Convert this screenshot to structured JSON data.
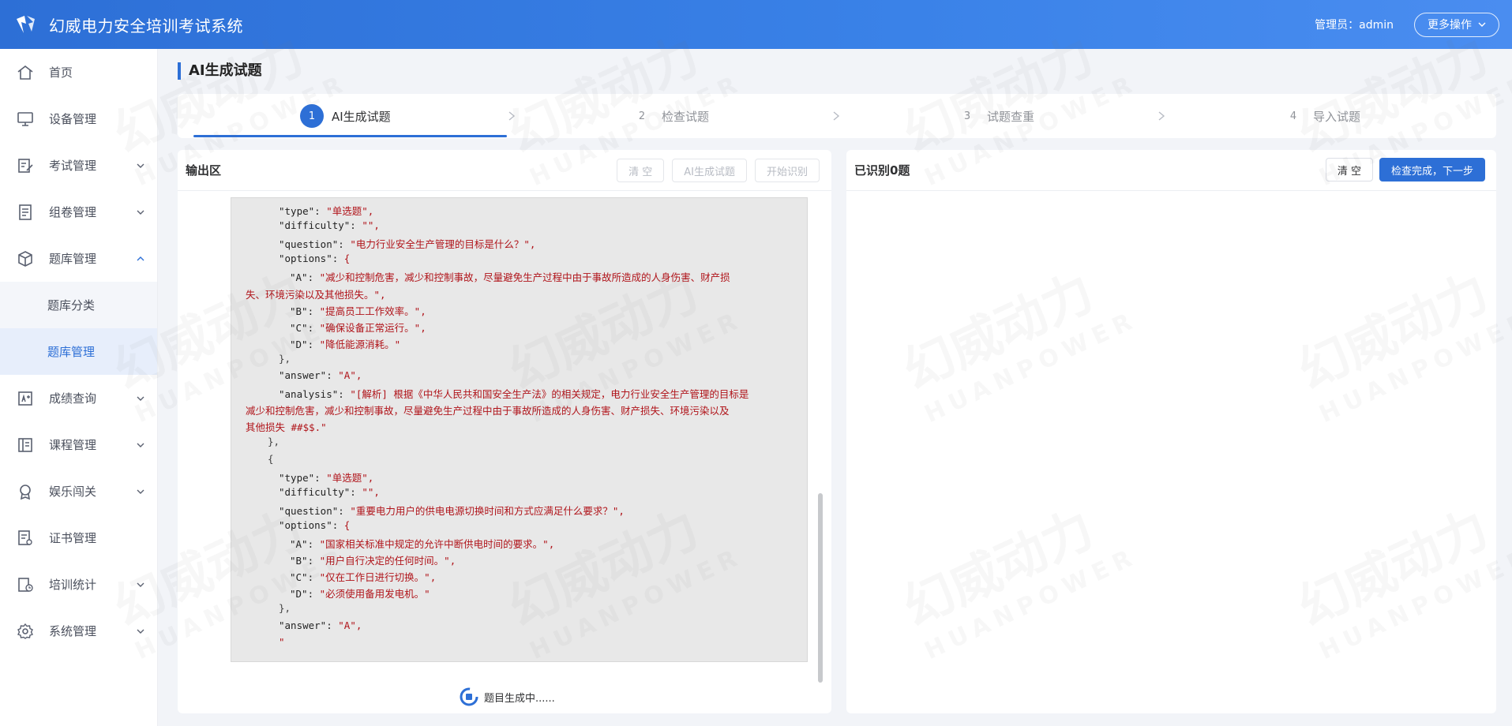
{
  "header": {
    "app_title": "幻威电力安全培训考试系统",
    "admin_label": "管理员：admin",
    "more_label": "更多操作"
  },
  "sidebar": {
    "items": [
      {
        "label": "首页",
        "icon": "home-icon"
      },
      {
        "label": "设备管理",
        "icon": "monitor-icon"
      },
      {
        "label": "考试管理",
        "icon": "edit-doc-icon"
      },
      {
        "label": "组卷管理",
        "icon": "paper-icon"
      },
      {
        "label": "题库管理",
        "icon": "box-icon"
      },
      {
        "label": "成绩查询",
        "icon": "score-icon"
      },
      {
        "label": "课程管理",
        "icon": "course-icon"
      },
      {
        "label": "娱乐闯关",
        "icon": "badge-icon"
      },
      {
        "label": "证书管理",
        "icon": "certificate-icon"
      },
      {
        "label": "培训统计",
        "icon": "stats-icon"
      },
      {
        "label": "系统管理",
        "icon": "gear-icon"
      }
    ],
    "sub_items": [
      {
        "label": "题库分类"
      },
      {
        "label": "题库管理"
      }
    ]
  },
  "page": {
    "title": "AI生成试题"
  },
  "steps": [
    {
      "num": "1",
      "label": "AI生成试题"
    },
    {
      "num": "2",
      "label": "检查试题"
    },
    {
      "num": "3",
      "label": "试题查重"
    },
    {
      "num": "4",
      "label": "导入试题"
    }
  ],
  "output_panel": {
    "title": "输出区",
    "btn_clear": "清 空",
    "btn_generate": "AI生成试题",
    "btn_recognize": "开始识别",
    "loading": "题目生成中......"
  },
  "code_lines": [
    {
      "t": "\"type\": \"单选题\","
    },
    {
      "t": "\"difficulty\": \"\","
    },
    {
      "t": "\"question\": \"电力行业安全生产管理的目标是什么？\","
    },
    {
      "t": "\"options\": {"
    },
    {
      "t": "\"A\": \"减少和控制危害，减少和控制事故，尽量避免生产过程中由于事故所造成的人身伤害、财产损"
    },
    {
      "t": "失、环境污染以及其他损失。\","
    },
    {
      "t": "\"B\": \"提高员工工作效率。\","
    },
    {
      "t": "\"C\": \"确保设备正常运行。\","
    },
    {
      "t": "\"D\": \"降低能源消耗。\""
    },
    {
      "t": "},"
    },
    {
      "t": "\"answer\": \"A\","
    },
    {
      "t": "\"analysis\": \"[解析] 根据《中华人民共和国安全生产法》的相关规定，电力行业安全生产管理的目标是"
    },
    {
      "t": "减少和控制危害，减少和控制事故，尽量避免生产过程中由于事故所造成的人身伤害、财产损失、环境污染以及"
    },
    {
      "t": "其他损失 ##$$.\""
    },
    {
      "t": "},"
    },
    {
      "t": "{"
    },
    {
      "t": "\"type\": \"单选题\","
    },
    {
      "t": "\"difficulty\": \"\","
    },
    {
      "t": "\"question\": \"重要电力用户的供电电源切换时间和方式应满足什么要求？\","
    },
    {
      "t": "\"options\": {"
    },
    {
      "t": "\"A\": \"国家相关标准中规定的允许中断供电时间的要求。\","
    },
    {
      "t": "\"B\": \"用户自行决定的任何时间。\","
    },
    {
      "t": "\"C\": \"仅在工作日进行切换。\","
    },
    {
      "t": "\"D\": \"必须使用备用发电机。\""
    },
    {
      "t": "},"
    },
    {
      "t": "\"answer\": \"A\","
    },
    {
      "t": "\""
    }
  ],
  "recognized_panel": {
    "title": "已识别0题",
    "btn_clear": "清 空",
    "btn_next": "检查完成，下一步"
  },
  "watermark": {
    "cn": "幻威动力",
    "en": "HUANPOWER"
  },
  "colors": {
    "primary": "#2d6fd6",
    "code_string": "#b0141a",
    "code_bg": "#e8e8e8"
  }
}
